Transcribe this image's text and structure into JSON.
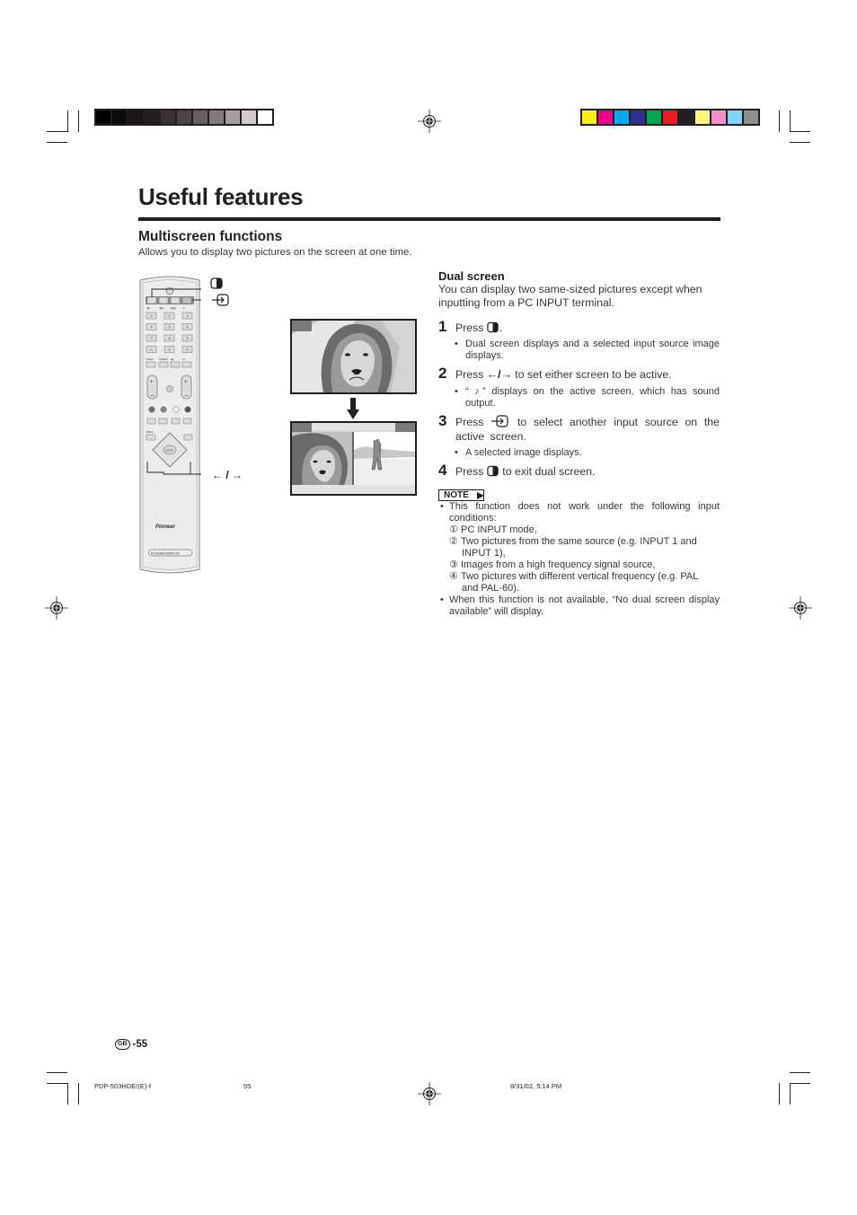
{
  "page": {
    "title": "Useful features",
    "section_title": "Multiscreen functions",
    "section_description": "Allows you to display two pictures on the screen at one time."
  },
  "color_bars": {
    "grayscale": [
      "#000000",
      "#0d0b0c",
      "#191516",
      "#252020",
      "#3b3132",
      "#4f4444",
      "#6a5f5f",
      "#857a7a",
      "#a69d9d",
      "#d2caca",
      "#ffffff"
    ],
    "process": [
      "#fff200",
      "#ec008c",
      "#00aeef",
      "#2e3192",
      "#00a651",
      "#ed1c24",
      "#231f20",
      "#fff67f",
      "#f68ecb",
      "#7fd5f7",
      "#8e8e8e"
    ]
  },
  "remote": {
    "callouts": {
      "dual_screen_icon": "dual-screen-button",
      "input_icon": "input-button",
      "arrows_label": "← / →"
    },
    "brand": "Pioneer",
    "model_label": "PLASMA DISPLAY",
    "number_keys": [
      "1",
      "2",
      "3",
      "4",
      "5",
      "6",
      "7",
      "8",
      "9",
      "-/--",
      "0",
      "↺"
    ],
    "enter_label": "ENTER",
    "menu_label": "MENU"
  },
  "illustrations": {
    "before": "single-screen-lion",
    "after": "dual-screen-lion-and-golfer"
  },
  "dual_screen": {
    "heading": "Dual screen",
    "intro": "You can display two same-sized pictures except when inputting from a PC INPUT terminal.",
    "steps": [
      {
        "num": "1",
        "pre": "Press ",
        "post": ".",
        "bullet": "Dual screen displays and a selected input source image displays."
      },
      {
        "num": "2",
        "pre": "Press ",
        "arrows": "←/→",
        "post": " to set either screen to be active.",
        "bullet": "“ ♪” displays on the active screen, which has sound output."
      },
      {
        "num": "3",
        "pre": "Press ",
        "post": " to select another input source on the active screen.",
        "bullet": "A selected image displays."
      },
      {
        "num": "4",
        "pre": "Press ",
        "post": " to exit dual screen."
      }
    ]
  },
  "note": {
    "label": "NOTE",
    "bullet1": "This function does not work under the following input conditions:",
    "conditions": [
      {
        "num": "①",
        "text": "PC INPUT mode,"
      },
      {
        "num": "②",
        "text": "Two pictures from the same source (e.g. INPUT 1 and",
        "cont": "INPUT 1),"
      },
      {
        "num": "③",
        "text": "Images from a high frequency signal source,"
      },
      {
        "num": "④",
        "text": "Two pictures with different vertical frequency (e.g. PAL",
        "cont": "and PAL-60)."
      }
    ],
    "bullet2": "When this function is not available, “No dual screen display available” will display."
  },
  "footer": {
    "region_badge": "GB",
    "page_number": "-55",
    "file_name": "PDP-503HDE/(E)-f",
    "sheet_number": "55",
    "timestamp": "8/31/02, 5:14 PM"
  }
}
